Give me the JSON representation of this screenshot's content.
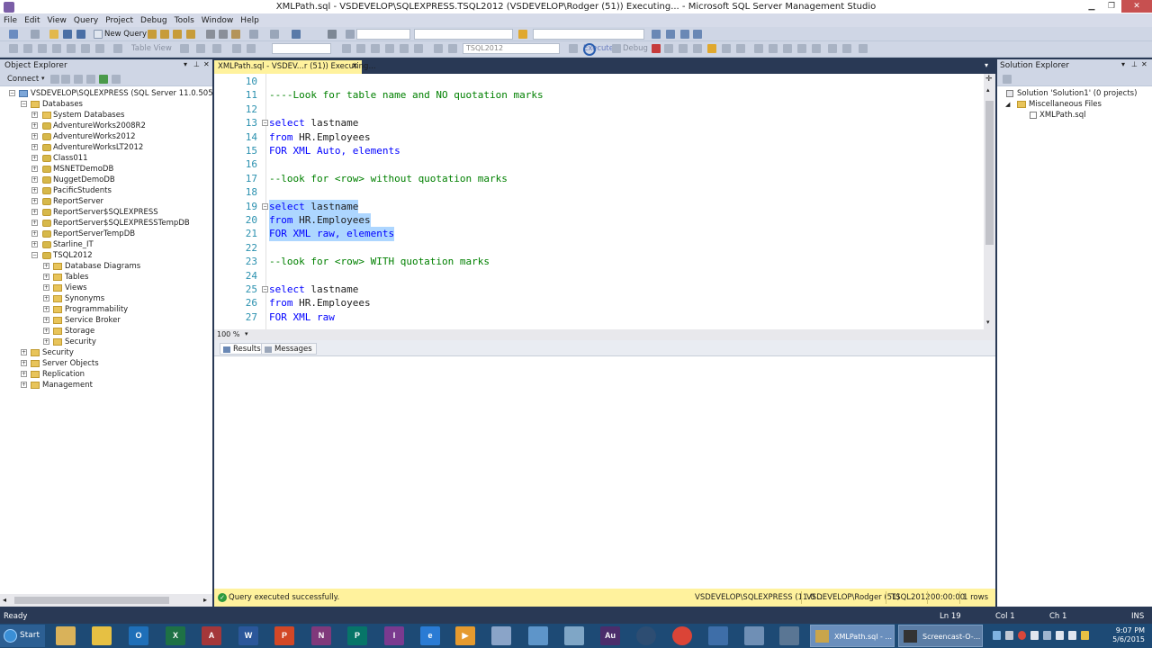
{
  "window": {
    "title": "XMLPath.sql - VSDEVELOP\\SQLEXPRESS.TSQL2012 (VSDEVELOP\\Rodger (51)) Executing... - Microsoft SQL Server Management Studio",
    "minimize_icon": "minimize-icon",
    "maximize_icon": "restore-icon",
    "close_icon": "close-icon"
  },
  "menu": [
    "File",
    "Edit",
    "View",
    "Query",
    "Project",
    "Debug",
    "Tools",
    "Window",
    "Help"
  ],
  "toolbar": {
    "new_query": "New Query",
    "table_view": "Table View",
    "database": "TSQL2012",
    "execute": "Execute",
    "debug": "Debug"
  },
  "object_explorer": {
    "title": "Object Explorer",
    "connect": "Connect",
    "server": "VSDEVELOP\\SQLEXPRESS (SQL Server 11.0.5058 - VSDEVELOP\\Rodger)",
    "databases": "Databases",
    "db_list": [
      "System Databases",
      "AdventureWorks2008R2",
      "AdventureWorks2012",
      "AdventureWorksLT2012",
      "Class011",
      "MSNETDemoDB",
      "NuggetDemoDB",
      "PacificStudents",
      "ReportServer",
      "ReportServer$SQLEXPRESS",
      "ReportServer$SQLEXPRESSTempDB",
      "ReportServerTempDB",
      "Starline_IT",
      "TSQL2012"
    ],
    "tsql_children": [
      "Database Diagrams",
      "Tables",
      "Views",
      "Synonyms",
      "Programmability",
      "Service Broker",
      "Storage",
      "Security"
    ],
    "top_level": [
      "Security",
      "Server Objects",
      "Replication",
      "Management"
    ]
  },
  "editor": {
    "tab_label": "XMLPath.sql - VSDEV...r (51)) Executing...",
    "zoom": "100 %",
    "lines": [
      {
        "n": "10",
        "text": ""
      },
      {
        "n": "11",
        "text": "----Look for table name and NO quotation marks"
      },
      {
        "n": "12",
        "text": ""
      },
      {
        "n": "13",
        "kw1": "select",
        "rest1": " lastname"
      },
      {
        "n": "14",
        "kw1": "from",
        "rest1": " HR.Employees"
      },
      {
        "n": "15",
        "kw1": "FOR XML Auto, elements"
      },
      {
        "n": "16",
        "text": ""
      },
      {
        "n": "17",
        "text": "--look for <row> without quotation marks"
      },
      {
        "n": "18",
        "text": ""
      },
      {
        "n": "19",
        "kw1": "select",
        "rest1": " lastname"
      },
      {
        "n": "20",
        "kw1": "from",
        "rest1": " HR.Employees"
      },
      {
        "n": "21",
        "kw1": "FOR XML raw, elements"
      },
      {
        "n": "22",
        "text": ""
      },
      {
        "n": "23",
        "text": "--look for <row> WITH quotation marks"
      },
      {
        "n": "24",
        "text": ""
      },
      {
        "n": "25",
        "kw1": "select",
        "rest1": " lastname"
      },
      {
        "n": "26",
        "kw1": "from",
        "rest1": " HR.Employees"
      },
      {
        "n": "27",
        "kw1": "FOR XML raw"
      }
    ]
  },
  "results": {
    "tab_results": "Results",
    "tab_messages": "Messages"
  },
  "query_status": {
    "message": "Query executed successfully.",
    "server": "VSDEVELOP\\SQLEXPRESS (11.0 ...",
    "user": "VSDEVELOP\\Rodger (51)",
    "database": "TSQL2012",
    "elapsed": "00:00:00",
    "rows": "1 rows"
  },
  "solution_explorer": {
    "title": "Solution Explorer",
    "solution": "Solution 'Solution1' (0 projects)",
    "folder": "Miscellaneous Files",
    "file": "XMLPath.sql"
  },
  "statusbar": {
    "ready": "Ready",
    "ln": "Ln 19",
    "col": "Col 1",
    "ch": "Ch 1",
    "ins": "INS"
  },
  "taskbar": {
    "start": "Start",
    "win1": "XMLPath.sql - ...",
    "win2": "Screencast-O-...",
    "time": "9:07 PM",
    "date": "5/6/2015"
  },
  "colors": {
    "keyword": "#0000ff",
    "comment": "#008000",
    "selection": "#add6ff",
    "status_yellow": "#fff29d",
    "frame": "#293955"
  }
}
